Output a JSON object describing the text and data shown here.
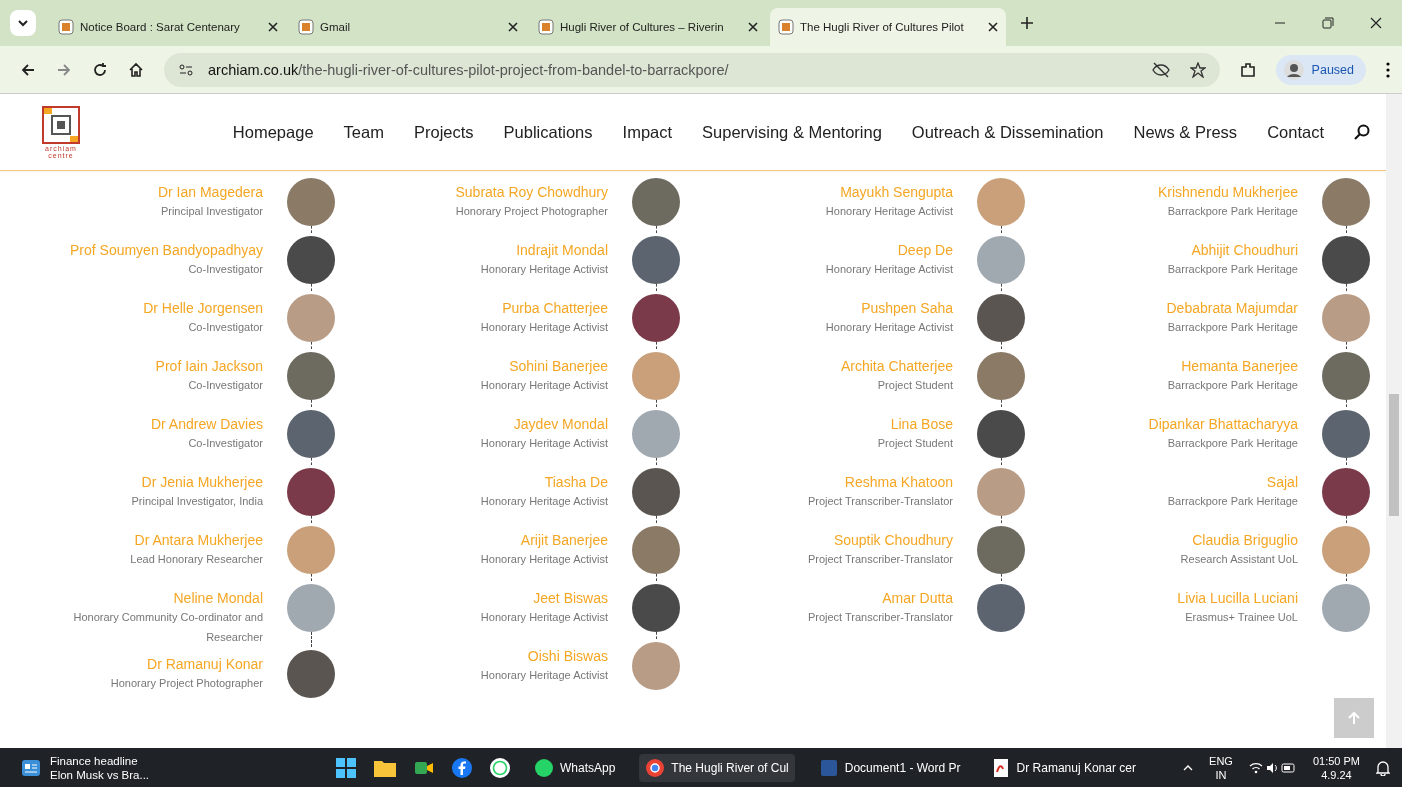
{
  "browser": {
    "tabs": [
      {
        "title": "Notice Board : Sarat Centenary",
        "selected": false
      },
      {
        "title": "Gmail",
        "selected": false
      },
      {
        "title": "Hugli River of Cultures – Riverin",
        "selected": false
      },
      {
        "title": "The Hugli River of Cultures Pilot",
        "selected": true
      }
    ],
    "url_domain": "archiam.co.uk",
    "url_path": "/the-hugli-river-of-cultures-pilot-project-from-bandel-to-barrackpore/",
    "profile_status": "Paused"
  },
  "site": {
    "logo_caption": "archiam centre",
    "nav": [
      "Homepage",
      "Team",
      "Projects",
      "Publications",
      "Impact",
      "Supervising & Mentoring",
      "Outreach & Dissemination",
      "News & Press",
      "Contact"
    ]
  },
  "team_columns": [
    [
      {
        "name": "Dr Ian Magedera",
        "role": "Principal Investigator"
      },
      {
        "name": "Prof Soumyen Bandyopadhyay",
        "role": "Co-Investigator"
      },
      {
        "name": "Dr Helle Jorgensen",
        "role": "Co-Investigator"
      },
      {
        "name": "Prof Iain Jackson",
        "role": "Co-Investigator"
      },
      {
        "name": "Dr Andrew Davies",
        "role": "Co-Investigator"
      },
      {
        "name": "Dr Jenia Mukherjee",
        "role": "Principal Investigator, India"
      },
      {
        "name": "Dr Antara Mukherjee",
        "role": "Lead Honorary Researcher"
      },
      {
        "name": "Neline Mondal",
        "role": "Honorary Community Co-ordinator and Researcher"
      },
      {
        "name": "Dr Ramanuj Konar",
        "role": "Honorary Project Photographer"
      }
    ],
    [
      {
        "name": "Subrata Roy Chowdhury",
        "role": "Honorary Project Photographer"
      },
      {
        "name": "Indrajit Mondal",
        "role": "Honorary Heritage Activist"
      },
      {
        "name": "Purba Chatterjee",
        "role": "Honorary Heritage Activist"
      },
      {
        "name": "Sohini Banerjee",
        "role": "Honorary Heritage Activist"
      },
      {
        "name": "Jaydev Mondal",
        "role": "Honorary Heritage Activist"
      },
      {
        "name": "Tiasha De",
        "role": "Honorary Heritage Activist"
      },
      {
        "name": "Arijit Banerjee",
        "role": "Honorary Heritage Activist"
      },
      {
        "name": "Jeet Biswas",
        "role": "Honorary Heritage Activist"
      },
      {
        "name": "Oishi Biswas",
        "role": "Honorary Heritage Activist"
      }
    ],
    [
      {
        "name": "Mayukh Sengupta",
        "role": "Honorary Heritage Activist"
      },
      {
        "name": "Deep De",
        "role": "Honorary Heritage Activist"
      },
      {
        "name": "Pushpen Saha",
        "role": "Honorary Heritage Activist"
      },
      {
        "name": "Archita Chatterjee",
        "role": "Project Student"
      },
      {
        "name": "Lina Bose",
        "role": "Project Student"
      },
      {
        "name": "Reshma Khatoon",
        "role": "Project Transcriber-Translator"
      },
      {
        "name": "Souptik Choudhury",
        "role": "Project Transcriber-Translator"
      },
      {
        "name": "Amar Dutta",
        "role": "Project Transcriber-Translator"
      }
    ],
    [
      {
        "name": "Krishnendu Mukherjee",
        "role": "Barrackpore Park Heritage"
      },
      {
        "name": "Abhijit Choudhuri",
        "role": "Barrackpore Park Heritage"
      },
      {
        "name": "Debabrata Majumdar",
        "role": "Barrackpore Park Heritage"
      },
      {
        "name": "Hemanta Banerjee",
        "role": "Barrackpore Park Heritage"
      },
      {
        "name": "Dipankar Bhattacharyya",
        "role": "Barrackpore Park Heritage"
      },
      {
        "name": "Sajal",
        "role": "Barrackpore Park Heritage"
      },
      {
        "name": "Claudia Briguglio",
        "role": "Research Assistant UoL"
      },
      {
        "name": "Livia Lucilla Luciani",
        "role": "Erasmus+ Trainee UoL"
      }
    ]
  ],
  "taskbar": {
    "widget_title": "Finance headline",
    "widget_text": "Elon Musk vs Bra...",
    "apps": [
      {
        "kind": "icon"
      },
      {
        "kind": "labeled",
        "label": "WhatsApp"
      },
      {
        "kind": "labeled",
        "label": "The Hugli River of Cul"
      },
      {
        "kind": "labeled",
        "label": "Document1 - Word Pr"
      },
      {
        "kind": "labeled",
        "label": "Dr Ramanuj Konar cer"
      }
    ],
    "language": "ENG",
    "region": "IN",
    "time": "01:50 PM",
    "date": "4.9.24"
  }
}
